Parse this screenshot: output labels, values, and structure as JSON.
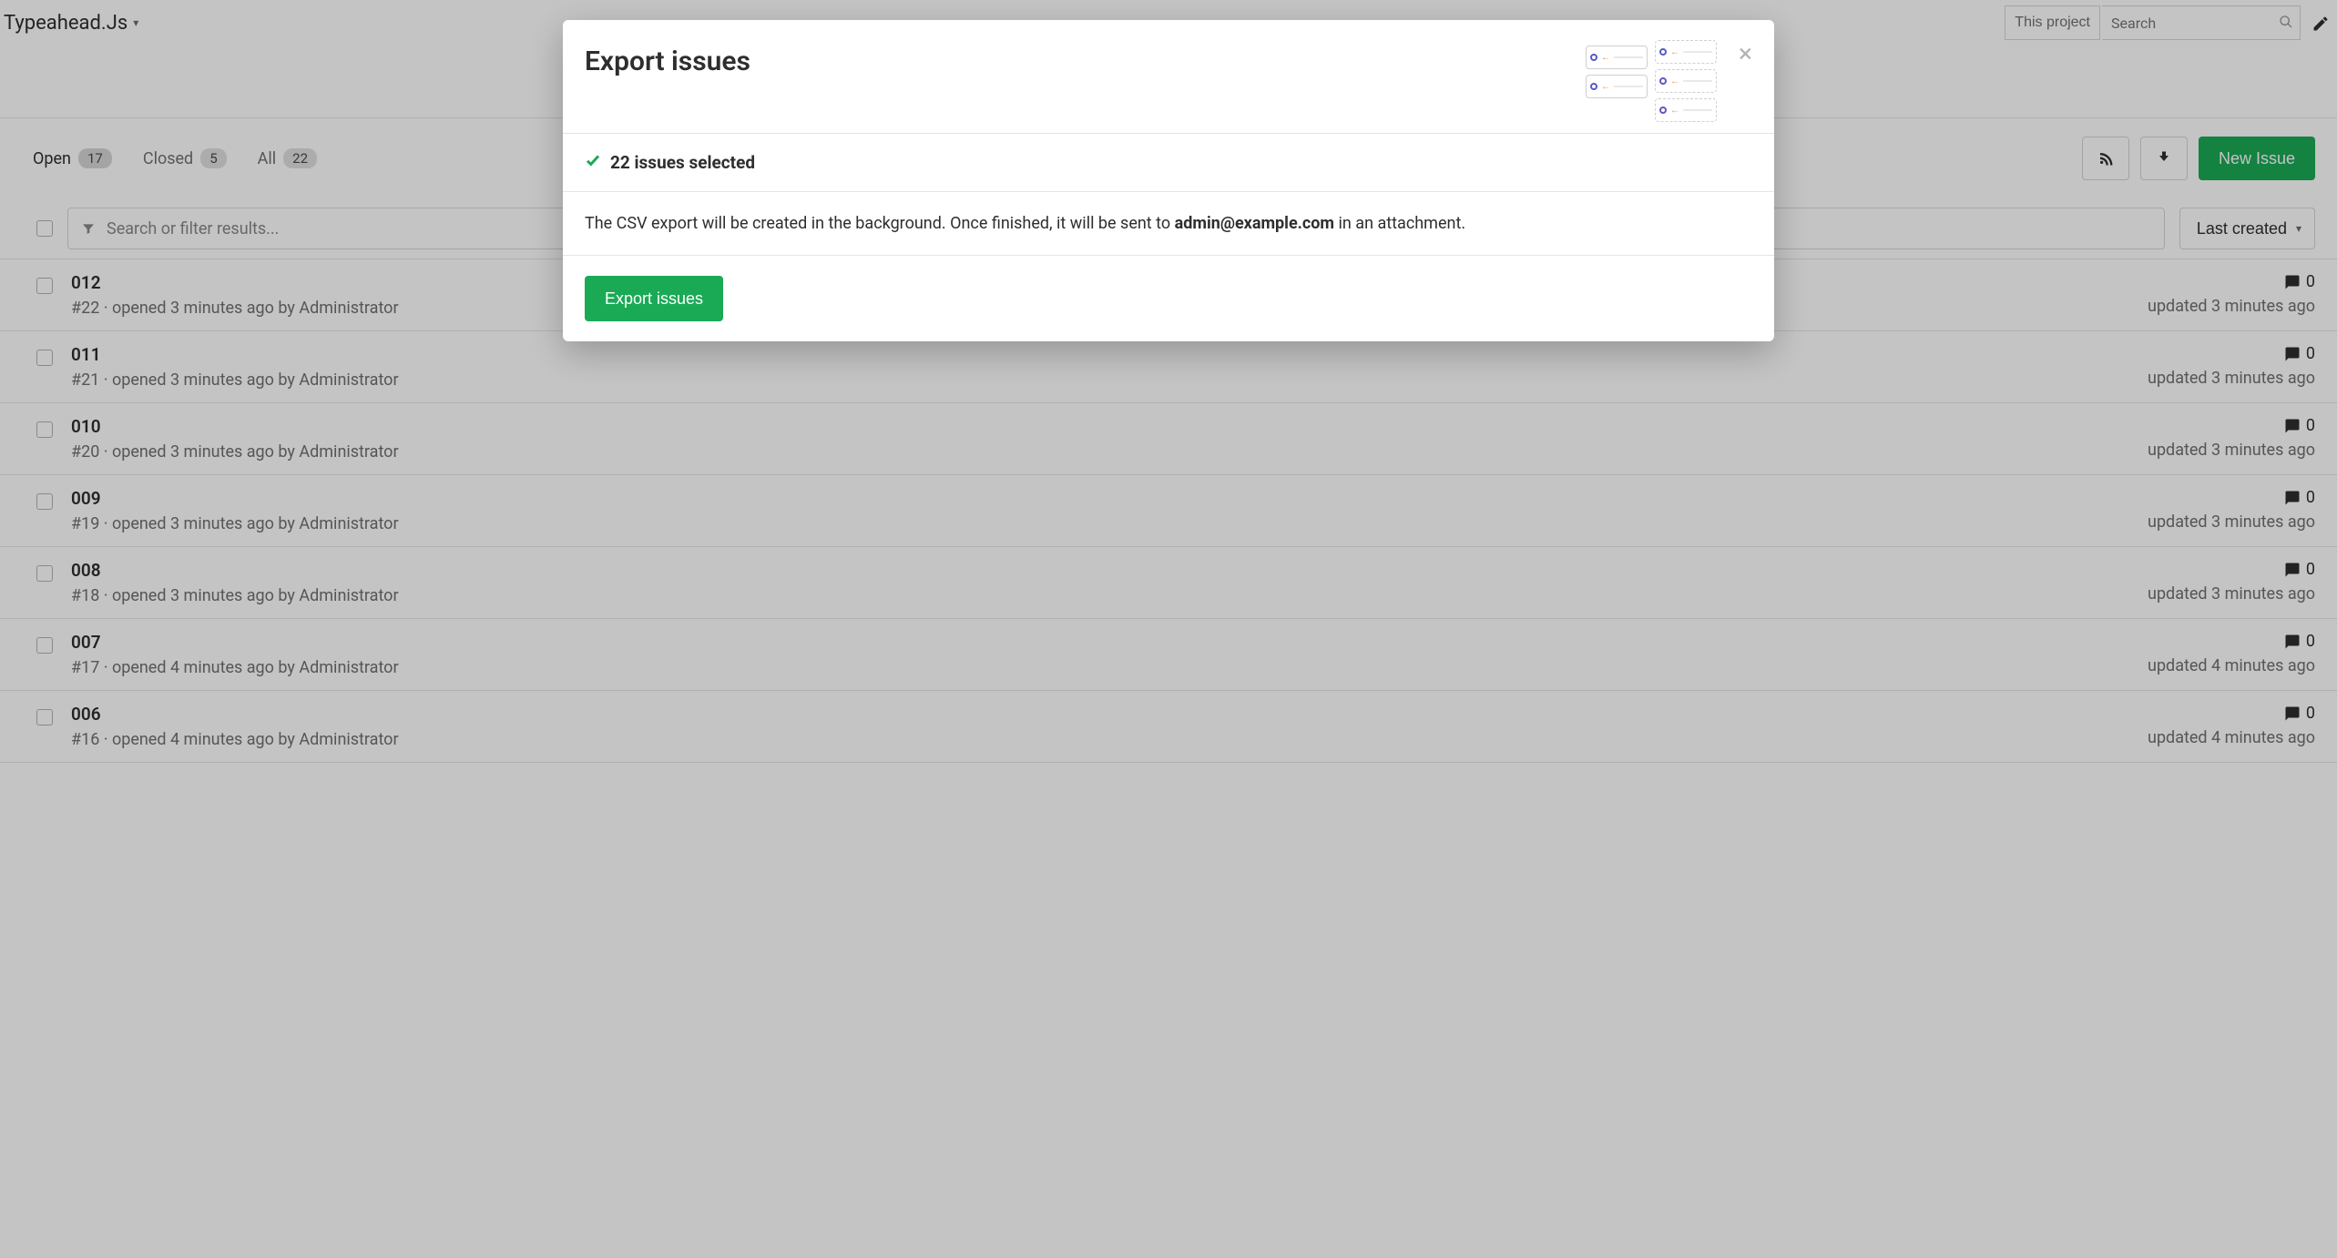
{
  "project_name": "Typeahead.Js",
  "search": {
    "scope_label": "This project",
    "placeholder": "Search"
  },
  "tabs": {
    "open_label": "Open",
    "open_count": "17",
    "closed_label": "Closed",
    "closed_count": "5",
    "all_label": "All",
    "all_count": "22"
  },
  "new_issue_label": "New Issue",
  "filter_placeholder": "Search or filter results...",
  "sort_label": "Last created",
  "issues": [
    {
      "title": "012",
      "meta": "#22 · opened 3 minutes ago by Administrator",
      "comments": "0",
      "updated": "updated 3 minutes ago"
    },
    {
      "title": "011",
      "meta": "#21 · opened 3 minutes ago by Administrator",
      "comments": "0",
      "updated": "updated 3 minutes ago"
    },
    {
      "title": "010",
      "meta": "#20 · opened 3 minutes ago by Administrator",
      "comments": "0",
      "updated": "updated 3 minutes ago"
    },
    {
      "title": "009",
      "meta": "#19 · opened 3 minutes ago by Administrator",
      "comments": "0",
      "updated": "updated 3 minutes ago"
    },
    {
      "title": "008",
      "meta": "#18 · opened 3 minutes ago by Administrator",
      "comments": "0",
      "updated": "updated 3 minutes ago"
    },
    {
      "title": "007",
      "meta": "#17 · opened 4 minutes ago by Administrator",
      "comments": "0",
      "updated": "updated 4 minutes ago"
    },
    {
      "title": "006",
      "meta": "#16 · opened 4 minutes ago by Administrator",
      "comments": "0",
      "updated": "updated 4 minutes ago"
    }
  ],
  "modal": {
    "title": "Export issues",
    "selected": "22 issues selected",
    "desc_pre": "The CSV export will be created in the background. Once finished, it will be sent to ",
    "email": "admin@example.com",
    "desc_post": " in an attachment.",
    "button_label": "Export issues"
  }
}
